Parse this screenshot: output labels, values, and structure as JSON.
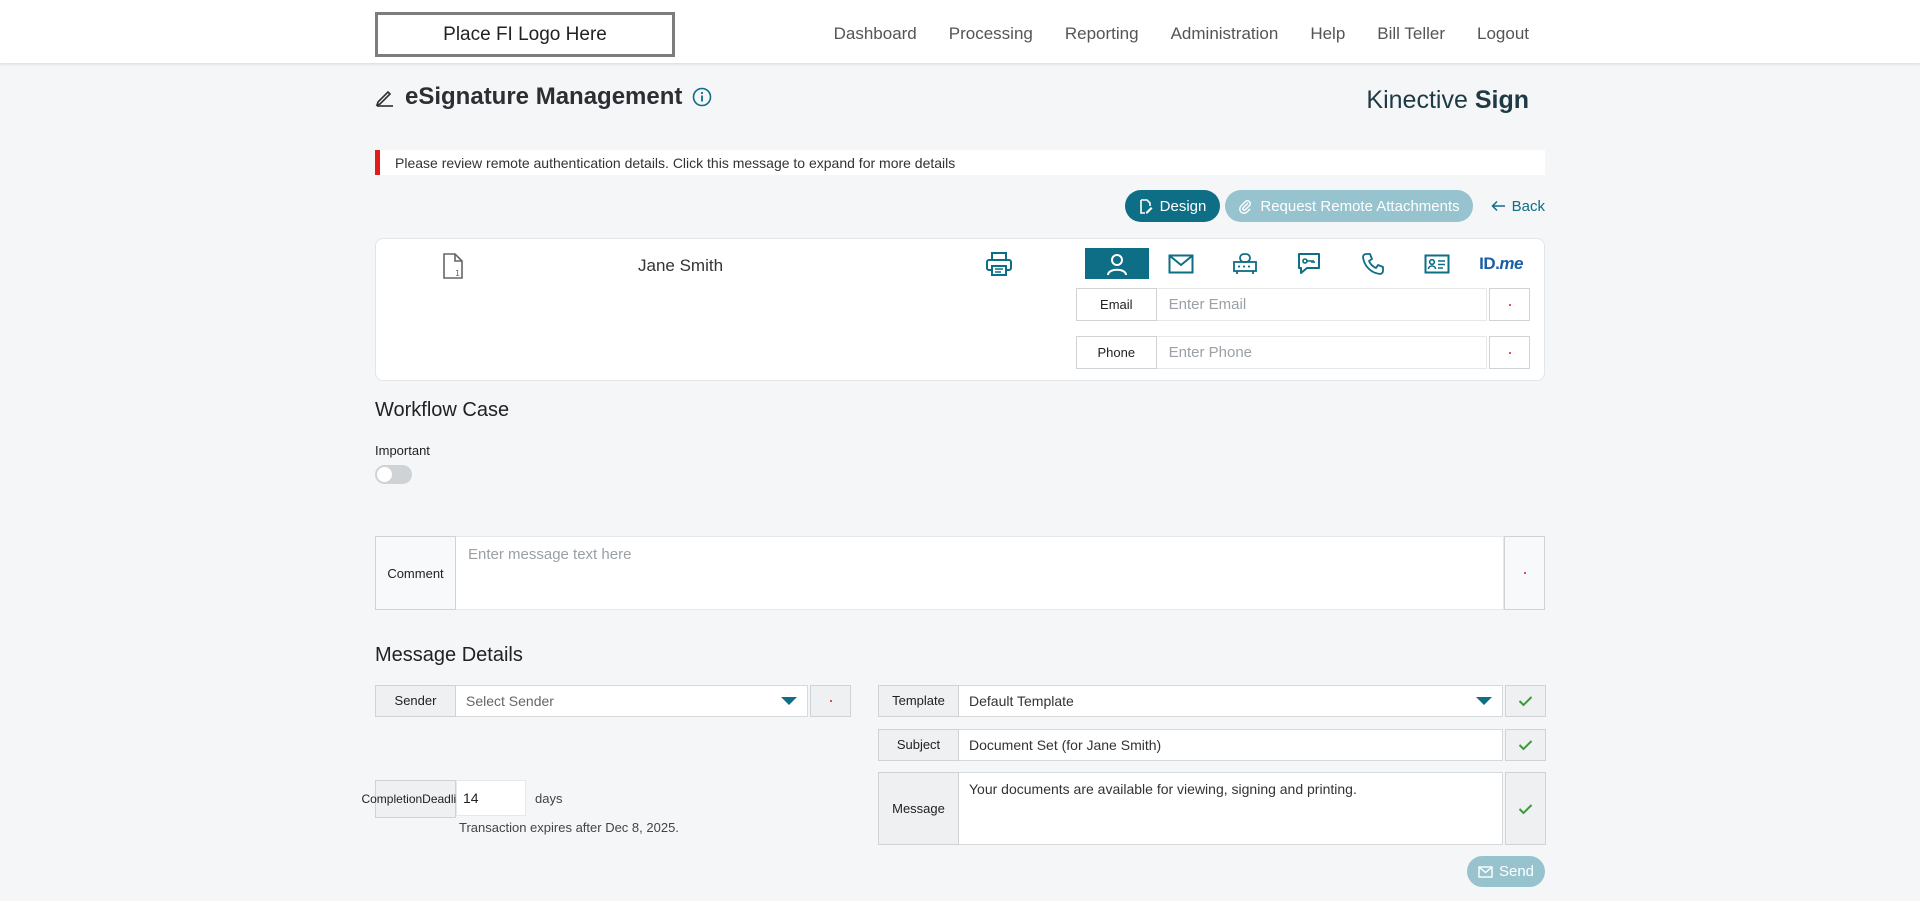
{
  "header": {
    "logo_text": "Place FI Logo Here",
    "nav": [
      "Dashboard",
      "Processing",
      "Reporting",
      "Administration",
      "Help",
      "Bill Teller",
      "Logout"
    ]
  },
  "page": {
    "title": "eSignature Management",
    "brand_light": "Kinective",
    "brand_bold": "Sign"
  },
  "alert": {
    "text": "Please review remote authentication details. Click this message to expand for more details",
    "color": "#e21b1b"
  },
  "actions": {
    "design": "Design",
    "request_remote": "Request Remote Attachments",
    "back": "Back"
  },
  "signer": {
    "name": "Jane Smith",
    "auth_tabs": [
      "person-icon",
      "mail-icon",
      "router-icon",
      "chat-key-icon",
      "phone-icon",
      "id-card-icon",
      "idme-logo"
    ],
    "idme_main": "ID.",
    "idme_italic": "me",
    "email_label": "Email",
    "email_placeholder": "Enter Email",
    "phone_label": "Phone",
    "phone_placeholder": "Enter Phone"
  },
  "workflow": {
    "heading": "Workflow Case",
    "important_label": "Important",
    "important_on": false,
    "comment_label": "Comment",
    "comment_placeholder": "Enter message text here"
  },
  "message_details": {
    "heading": "Message Details",
    "sender_label": "Sender",
    "sender_placeholder": "Select Sender",
    "deadline_label_1": "Completion",
    "deadline_label_2": "Deadline",
    "deadline_value": "14",
    "deadline_unit": "days",
    "expires_text": "Transaction expires after Dec 8, 2025.",
    "template_label": "Template",
    "template_value": "Default Template",
    "subject_label": "Subject",
    "subject_value": "Document Set (for Jane Smith)",
    "message_label": "Message",
    "message_value": "Your documents are available for viewing, signing and printing.",
    "send": "Send"
  },
  "colors": {
    "accent": "#0d6e85",
    "accent_disabled": "#97c3ce",
    "check_green": "#3a9a3a"
  }
}
